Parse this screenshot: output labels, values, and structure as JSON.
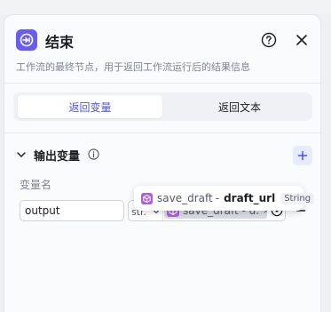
{
  "header": {
    "title": "结束",
    "description": "工作流的最终节点，用于返回工作流运行后的结果信息",
    "accent": "#6a5cf0"
  },
  "tabs": [
    {
      "label": "返回变量",
      "active": true
    },
    {
      "label": "返回文本",
      "active": false
    }
  ],
  "section": {
    "title": "输出变量",
    "column_label": "变量名"
  },
  "row": {
    "name_value": "output",
    "type_value": "str.",
    "reference_label": "save_draft - d."
  },
  "tooltip": {
    "node_name": "save_draft",
    "separator": "-",
    "variable_name": "draft_url",
    "type": "String"
  },
  "icons": {
    "node": "end-node-icon",
    "help": "question-circle-icon",
    "close": "close-icon",
    "collapse": "chevron-down-icon",
    "info": "info-icon",
    "add": "plus-icon",
    "remove": "minus-icon",
    "reference": "cube-icon",
    "target": "target-icon"
  }
}
